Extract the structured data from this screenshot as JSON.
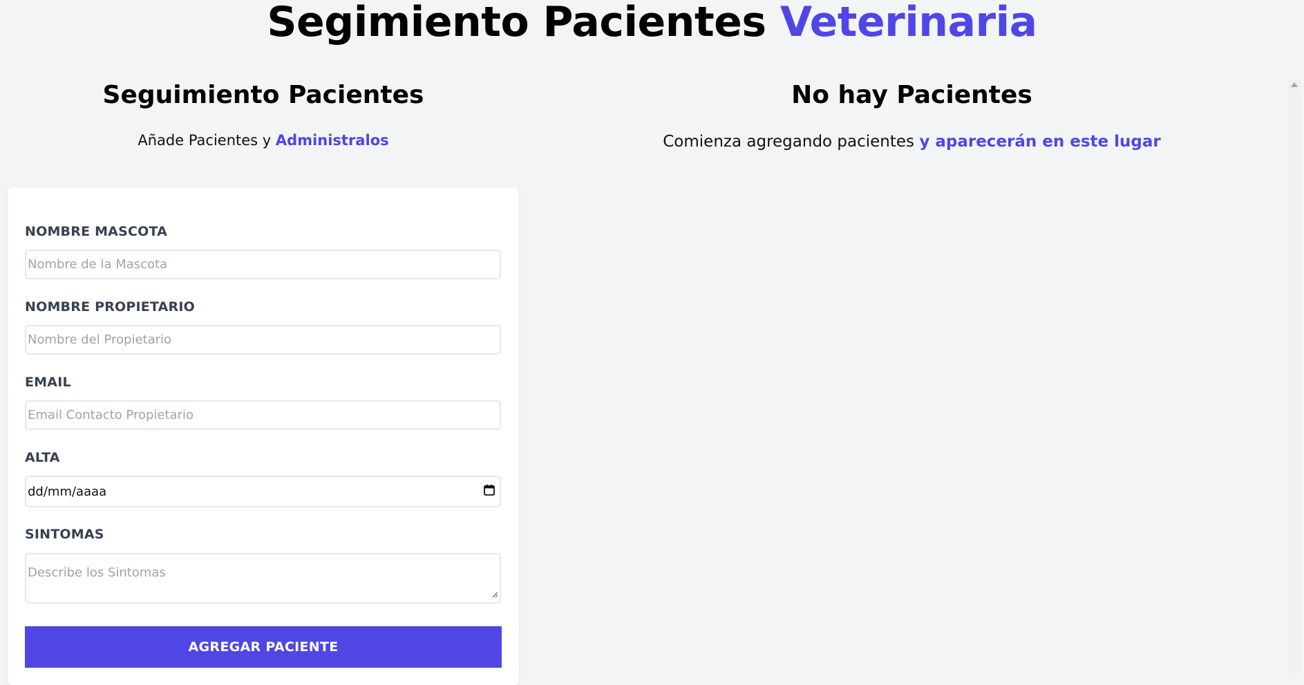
{
  "header": {
    "title": "Segimiento Pacientes",
    "title_accent": "Veterinaria"
  },
  "form_section": {
    "title": "Seguimiento Pacientes",
    "subtitle": "Añade Pacientes y",
    "subtitle_accent": "Administralos"
  },
  "form": {
    "pet_name": {
      "label": "NOMBRE MASCOTA",
      "placeholder": "Nombre de la Mascota",
      "value": ""
    },
    "owner_name": {
      "label": "NOMBRE PROPIETARIO",
      "placeholder": "Nombre del Propietario",
      "value": ""
    },
    "email": {
      "label": "EMAIL",
      "placeholder": "Email Contacto Propietario",
      "value": ""
    },
    "discharge": {
      "label": "ALTA",
      "display": "dd/mm/aaaa"
    },
    "symptoms": {
      "label": "SINTOMAS",
      "placeholder": "Describe los Sintomas"
    },
    "submit_label": "AGREGAR PACIENTE"
  },
  "list_section": {
    "title": "No hay Pacientes",
    "subtitle": "Comienza agregando pacientes",
    "subtitle_accent": "y aparecerán en este lugar"
  },
  "icons": {
    "date_picker": "calendar-icon",
    "textarea_resize": "resize-handle-icon"
  },
  "colors": {
    "accent": "#4f46e5",
    "background": "#f3f4f6",
    "card": "#ffffff"
  }
}
